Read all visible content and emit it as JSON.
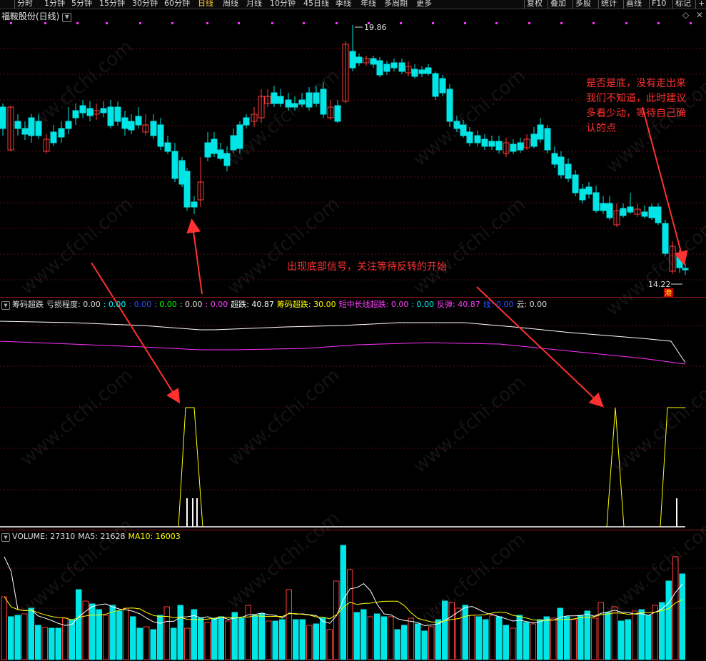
{
  "topbar": {
    "periods": [
      "分时",
      "1分钟",
      "5分钟",
      "15分钟",
      "30分钟",
      "60分钟",
      "日线",
      "周线",
      "月线",
      "10分钟",
      "45日线",
      "季线",
      "年线",
      "多周期",
      "更多"
    ],
    "active_index": 6,
    "right_items": [
      "复权",
      "叠加",
      "多股",
      "统计",
      "画线",
      "F10",
      "标记",
      "+自"
    ]
  },
  "stock": {
    "title": "福鞍股份(日线)"
  },
  "price_panel": {
    "high_label": "19.86",
    "low_label": "14.22",
    "hk_tag": "港",
    "annotation_bottom_signal": "出现底部信号，关注等待反转的开始",
    "annotation_right_lines": [
      "是否是底，没有走出来",
      "我们不知道，此时建议",
      "多看少动，等待自己确",
      "认的点"
    ]
  },
  "indicator": {
    "name": "筹码超跌",
    "items": [
      {
        "text": "亏损程度: 0.00",
        "color": "#e0e0e0"
      },
      {
        "text": ": 0.00",
        "color": "#00ffff"
      },
      {
        "text": ": 0.00",
        "color": "#3050ff"
      },
      {
        "text": ": 0.00",
        "color": "#00ff00"
      },
      {
        "text": ": 0.00",
        "color": "#e0e0e0"
      },
      {
        "text": ": 0.00",
        "color": "#ff40ff"
      },
      {
        "text": "超跌: 40.87",
        "color": "#ffffff"
      },
      {
        "text": "筹码超跌: 30.00",
        "color": "#ffff00"
      },
      {
        "text": "短中长线超跌: 0.00",
        "color": "#ff40ff"
      },
      {
        "text": ": 0.00",
        "color": "#00ffff"
      },
      {
        "text": "反弹: 40.87",
        "color": "#ff40ff"
      },
      {
        "text": "线: 0.00",
        "color": "#3050ff"
      },
      {
        "text": "云: 0.00",
        "color": "#e0e0e0"
      }
    ]
  },
  "volume": {
    "label": "VOLUME: 27310",
    "ma5": "MA5: 21628",
    "ma10": "MA10: 16003"
  },
  "watermark": "www.cfchi.com",
  "colors": {
    "up": "#ff3b3b",
    "down": "#00e5e5",
    "annotation": "#ff3030",
    "magenta": "#ff30ff",
    "yellow": "#ffff00",
    "divider": "#8a1818"
  }
}
